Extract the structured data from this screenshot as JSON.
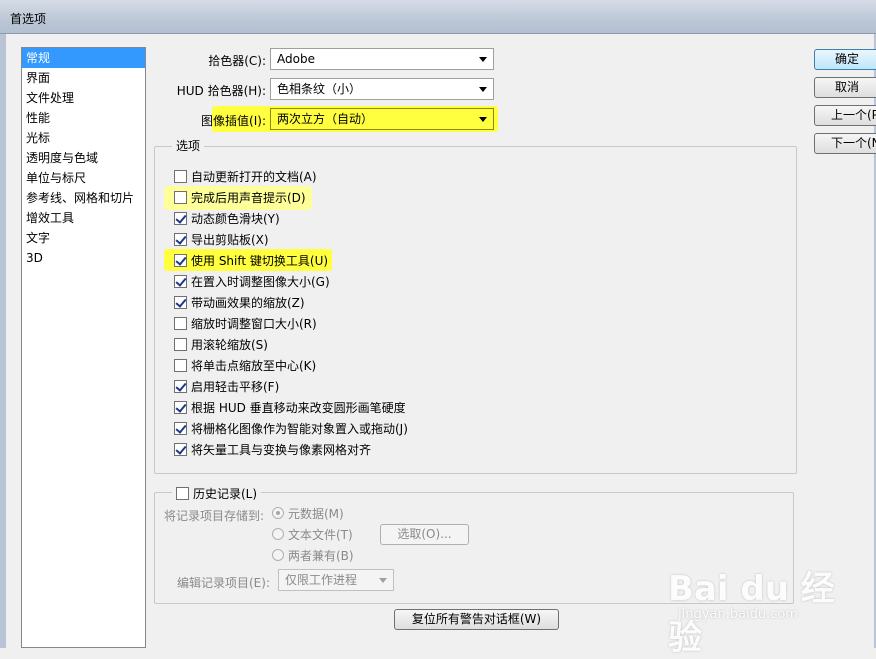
{
  "window": {
    "title": "首选项"
  },
  "categories": [
    "常规",
    "界面",
    "文件处理",
    "性能",
    "光标",
    "透明度与色域",
    "单位与标尺",
    "参考线、网格和切片",
    "增效工具",
    "文字",
    "3D"
  ],
  "fields": {
    "color_picker": {
      "label": "拾色器(C):",
      "value": "Adobe"
    },
    "hud_picker": {
      "label": "HUD 拾色器(H):",
      "value": "色相条纹（小）"
    },
    "interpolation": {
      "label": "图像插值(I):",
      "value": "两次立方（自动）"
    }
  },
  "options_group": {
    "legend": "选项",
    "items": [
      {
        "label": "自动更新打开的文档(A)",
        "checked": false
      },
      {
        "label": "完成后用声音提示(D)",
        "checked": false
      },
      {
        "label": "动态颜色滑块(Y)",
        "checked": true
      },
      {
        "label": "导出剪贴板(X)",
        "checked": true
      },
      {
        "label": "使用 Shift 键切换工具(U)",
        "checked": true
      },
      {
        "label": "在置入时调整图像大小(G)",
        "checked": true
      },
      {
        "label": "带动画效果的缩放(Z)",
        "checked": true
      },
      {
        "label": "缩放时调整窗口大小(R)",
        "checked": false
      },
      {
        "label": "用滚轮缩放(S)",
        "checked": false
      },
      {
        "label": "将单击点缩放至中心(K)",
        "checked": false
      },
      {
        "label": "启用轻击平移(F)",
        "checked": true
      },
      {
        "label": "根据 HUD 垂直移动来改变圆形画笔硬度",
        "checked": true
      },
      {
        "label": "将栅格化图像作为智能对象置入或拖动(J)",
        "checked": true
      },
      {
        "label": "将矢量工具与变换与像素网格对齐",
        "checked": true
      }
    ]
  },
  "history_group": {
    "legend": "历史记录(L)",
    "checked": false,
    "store_label": "将记录项目存储到:",
    "radios": [
      {
        "label": "元数据(M)",
        "selected": true
      },
      {
        "label": "文本文件(T)",
        "selected": false
      },
      {
        "label": "两者兼有(B)",
        "selected": false
      }
    ],
    "choose_button": "选取(O)...",
    "edit_label": "编辑记录项目(E):",
    "edit_value": "仅限工作进程"
  },
  "reset_button": "复位所有警告对话框(W)",
  "side_buttons": {
    "ok": "确定",
    "cancel": "取消",
    "prev": "上一个(P)",
    "next": "下一个(N)"
  },
  "watermark": {
    "main": "Bai du 经验",
    "sub": "jingyan.baidu.com"
  }
}
